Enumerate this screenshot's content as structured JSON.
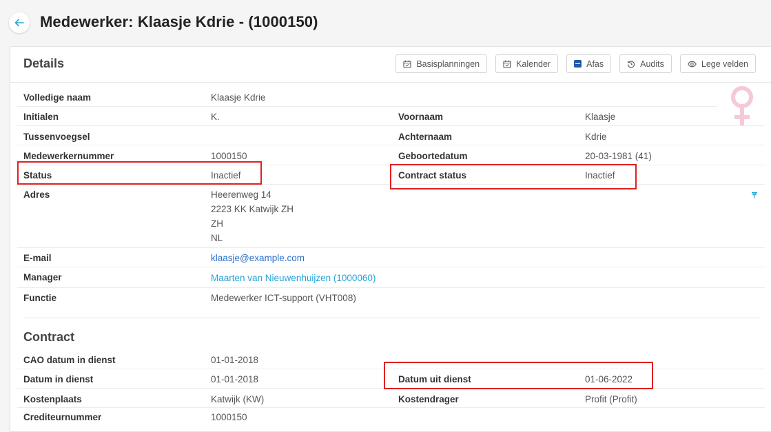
{
  "page": {
    "title": "Medewerker: Klaasje Kdrie - (1000150)"
  },
  "card": {
    "title": "Details",
    "toolbar": [
      {
        "label": "Basisplanningen",
        "icon": "calendar-icon"
      },
      {
        "label": "Kalender",
        "icon": "calendar-icon"
      },
      {
        "label": "Afas",
        "icon": "afas-icon"
      },
      {
        "label": "Audits",
        "icon": "history-icon"
      },
      {
        "label": "Lege velden",
        "icon": "eye-icon"
      }
    ]
  },
  "details": {
    "volledige_naam": {
      "label": "Volledige naam",
      "value": "Klaasje Kdrie"
    },
    "initialen": {
      "label": "Initialen",
      "value": "K."
    },
    "voornaam": {
      "label": "Voornaam",
      "value": "Klaasje"
    },
    "tussenvoegsel": {
      "label": "Tussenvoegsel",
      "value": ""
    },
    "achternaam": {
      "label": "Achternaam",
      "value": "Kdrie"
    },
    "medewerkernummer": {
      "label": "Medewerkernummer",
      "value": "1000150"
    },
    "geboortedatum": {
      "label": "Geboortedatum",
      "value": "20-03-1981 (41)"
    },
    "status": {
      "label": "Status",
      "value": "Inactief"
    },
    "contract_status": {
      "label": "Contract status",
      "value": "Inactief"
    },
    "adres": {
      "label": "Adres",
      "lines": [
        "Heerenweg 14",
        "2223 KK Katwijk ZH",
        "ZH",
        "NL"
      ]
    },
    "email": {
      "label": "E-mail",
      "value": "klaasje@example.com"
    },
    "manager": {
      "label": "Manager",
      "value": "Maarten van Nieuwenhuijzen (1000060)"
    },
    "functie": {
      "label": "Functie",
      "value": "Medewerker ICT-support (VHT008)"
    }
  },
  "contract": {
    "title": "Contract",
    "cao_datum": {
      "label": "CAO datum in dienst",
      "value": "01-01-2018"
    },
    "datum_in_dienst": {
      "label": "Datum in dienst",
      "value": "01-01-2018"
    },
    "datum_uit_dienst": {
      "label": "Datum uit dienst",
      "value": "01-06-2022"
    },
    "kostenplaats": {
      "label": "Kostenplaats",
      "value": "Katwijk (KW)"
    },
    "kostendrager": {
      "label": "Kostendrager",
      "value": "Profit (Profit)"
    },
    "crediteurnummer": {
      "label": "Crediteurnummer",
      "value": "1000150"
    }
  },
  "colors": {
    "accent": "#25a3d6",
    "link": "#2a6fc9",
    "highlight": "#e02020",
    "gender": "#f6c9d8"
  }
}
